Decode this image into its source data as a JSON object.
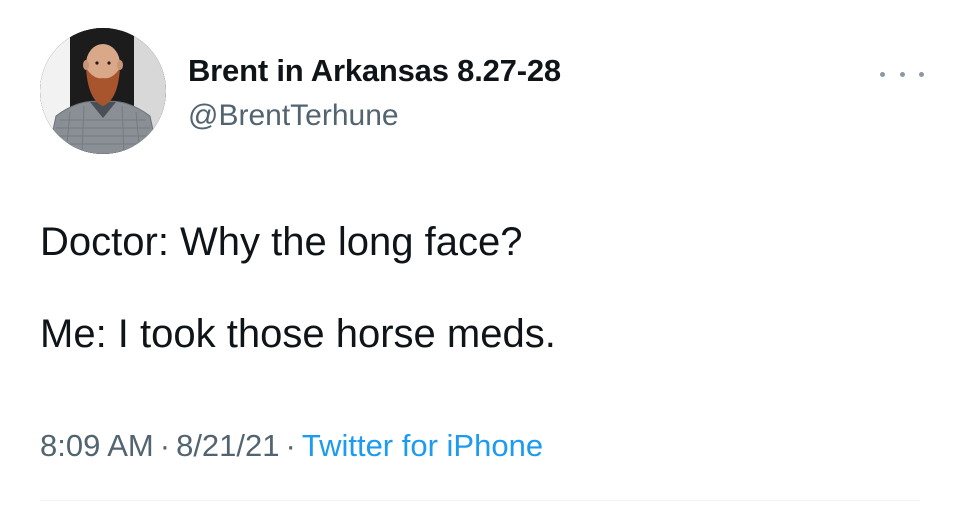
{
  "colors": {
    "text": "#0f1419",
    "secondary": "#536471",
    "link": "#1d9bf0",
    "divider": "#eff3f4"
  },
  "author": {
    "display_name": "Brent in Arkansas 8.27-28",
    "handle": "@BrentTerhune",
    "avatar_icon": "bearded-man-avatar"
  },
  "more_icon": "more-options-icon",
  "tweet": {
    "lines": [
      "Doctor: Why the long face?",
      "Me: I took those horse meds."
    ]
  },
  "meta": {
    "time": "8:09 AM",
    "separator": "·",
    "date": "8/21/21",
    "source": "Twitter for iPhone"
  }
}
